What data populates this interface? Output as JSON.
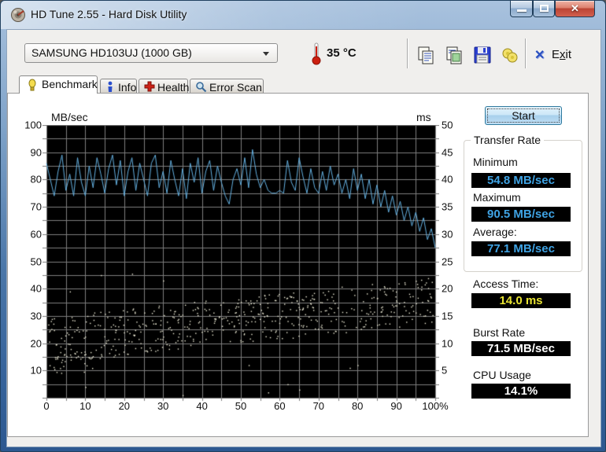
{
  "window": {
    "title": "HD Tune 2.55 - Hard Disk Utility",
    "controls": {
      "minimize": "minimize",
      "maximize": "maximize",
      "close": "close"
    }
  },
  "toolbar": {
    "drive_select": "SAMSUNG HD103UJ (1000 GB)",
    "temperature": "35 °C",
    "icons": [
      "copy-icon",
      "copy-image-icon",
      "save-icon",
      "options-icon"
    ],
    "exit": {
      "pre": "E",
      "key": "x",
      "post": "it"
    }
  },
  "tabs": [
    {
      "label": "Benchmark",
      "icon": "benchmark-icon",
      "active": true
    },
    {
      "label": "Info",
      "icon": "info-icon",
      "active": false
    },
    {
      "label": "Health",
      "icon": "health-icon",
      "active": false
    },
    {
      "label": "Error Scan",
      "icon": "error-scan-icon",
      "active": false
    }
  ],
  "results": {
    "start_label": "Start",
    "transfer_rate": {
      "title": "Transfer Rate",
      "minimum_label": "Minimum",
      "minimum": "54.8 MB/sec",
      "maximum_label": "Maximum",
      "maximum": "90.5 MB/sec",
      "average_label": "Average:",
      "average": "77.1 MB/sec"
    },
    "access_time_label": "Access Time:",
    "access_time": "14.0 ms",
    "burst_rate_label": "Burst Rate",
    "burst_rate": "71.5 MB/sec",
    "cpu_usage_label": "CPU Usage",
    "cpu_usage": "14.1%"
  },
  "chart_data": {
    "type": "line+scatter",
    "title": "HD Tune benchmark graph",
    "left_axis": {
      "label": "MB/sec",
      "min": 0,
      "max": 100,
      "ticks": [
        100,
        90,
        80,
        70,
        60,
        50,
        40,
        30,
        20,
        10
      ]
    },
    "right_axis": {
      "label": "ms",
      "min": 0,
      "max": 50,
      "ticks": [
        50,
        45,
        40,
        35,
        30,
        25,
        20,
        15,
        10,
        5
      ]
    },
    "x_axis": {
      "min": 0,
      "max": 100,
      "tick_labels": [
        "0",
        "10",
        "20",
        "30",
        "40",
        "50",
        "60",
        "70",
        "80",
        "90",
        "100%"
      ]
    },
    "grid": {
      "step_left_units": 5,
      "step_x_percent": 5,
      "color": "#7e7e7e",
      "bg": "#000000"
    },
    "series": [
      {
        "name": "transfer-rate",
        "type": "line",
        "color": "#64b1e2",
        "x_step_percent": 1,
        "values": [
          86,
          80,
          74,
          83,
          89,
          76,
          82,
          74,
          88,
          79,
          74,
          85,
          77,
          88,
          82,
          75,
          84,
          89,
          78,
          87,
          74,
          83,
          88,
          76,
          86,
          80,
          74,
          86,
          89,
          77,
          83,
          75,
          87,
          80,
          74,
          84,
          73,
          86,
          79,
          88,
          75,
          83,
          87,
          76,
          85,
          79,
          74,
          71,
          80,
          84,
          78,
          88,
          77,
          91,
          82,
          77,
          80,
          76,
          75,
          75,
          76,
          75,
          87,
          79,
          76,
          88,
          81,
          75,
          84,
          77,
          75,
          83,
          76,
          85,
          78,
          82,
          75,
          80,
          73,
          84,
          76,
          82,
          73,
          80,
          71,
          78,
          70,
          76,
          68,
          74,
          67,
          72,
          65,
          70,
          63,
          68,
          61,
          66,
          58,
          62,
          55
        ]
      },
      {
        "name": "access-time",
        "type": "scatter",
        "color": "#f0eed8",
        "units": "left-axis units (2 units = 1 ms)",
        "generator": {
          "seed": 42,
          "count": 520,
          "x_range": [
            0.3,
            99.7
          ],
          "y_base_start": 21,
          "y_base_end": 36,
          "y_spread": 8.5,
          "y_min": 9,
          "y_max": 44,
          "extra_low_left": {
            "count": 30,
            "x_range": [
              0.3,
              12
            ],
            "y_range": [
              9,
              17
            ]
          },
          "outliers": [
            [
              14,
              45
            ],
            [
              22,
              45.5
            ],
            [
              6,
              39
            ],
            [
              30,
              43
            ],
            [
              52,
              12
            ],
            [
              57,
              2
            ],
            [
              62,
              5
            ],
            [
              65,
              3
            ],
            [
              78,
              11
            ],
            [
              80,
              12
            ],
            [
              10,
              4
            ],
            [
              35,
              1
            ]
          ]
        }
      }
    ]
  }
}
